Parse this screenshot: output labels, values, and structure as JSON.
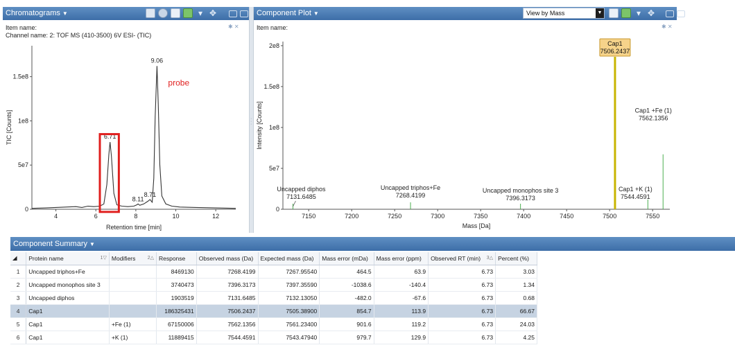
{
  "chromatogram": {
    "title": "Chromatograms",
    "item_name_label": "Item name:",
    "channel_label": "Channel name: 2: TOF MS (410-3500) 6V ESI- (TIC)",
    "annotation": "probe",
    "colors": {
      "trace": "#333333",
      "highlight_box": "#e0201f",
      "annotation": "#e0201f"
    },
    "chart_data": {
      "type": "line",
      "xlabel": "Retention time [min]",
      "ylabel": "TIC [Counts]",
      "xlim": [
        2.8,
        13.0
      ],
      "ylim": [
        0,
        185000000.0
      ],
      "x_ticks": [
        "4",
        "6",
        "8",
        "10",
        "12"
      ],
      "y_ticks": [
        "0",
        "5e7",
        "1e8",
        "1.5e8"
      ],
      "peak_labels": [
        {
          "x": 6.71,
          "y": 76000000.0,
          "text": "6.71"
        },
        {
          "x": 8.11,
          "y": 5000000.0,
          "text": "8.11"
        },
        {
          "x": 8.71,
          "y": 10000000.0,
          "text": "8.71"
        },
        {
          "x": 9.06,
          "y": 162000000.0,
          "text": "9.06"
        }
      ],
      "highlight_range": {
        "x": [
          6.2,
          7.15
        ],
        "y": [
          -3000000.0,
          85000000.0
        ]
      },
      "x": [
        2.8,
        3.5,
        4.0,
        4.5,
        5.0,
        5.3,
        5.6,
        5.9,
        6.2,
        6.4,
        6.55,
        6.65,
        6.71,
        6.78,
        6.9,
        7.05,
        7.3,
        7.6,
        7.9,
        8.05,
        8.11,
        8.2,
        8.4,
        8.6,
        8.71,
        8.82,
        8.9,
        8.97,
        9.06,
        9.12,
        9.2,
        9.3,
        9.5,
        9.8,
        10.2,
        11.0,
        12.0,
        13.0
      ],
      "y": [
        1000000.0,
        1500000.0,
        2000000.0,
        2500000.0,
        3000000.0,
        2000000.0,
        3500000.0,
        3000000.0,
        3500000.0,
        6000000.0,
        28000000.0,
        62000000.0,
        76000000.0,
        60000000.0,
        18000000.0,
        5000000.0,
        3500000.0,
        3000000.0,
        3500000.0,
        5000000.0,
        6000000.0,
        4500000.0,
        6000000.0,
        9000000.0,
        11000000.0,
        8000000.0,
        35000000.0,
        105000000.0,
        162000000.0,
        120000000.0,
        50000000.0,
        15000000.0,
        6000000.0,
        3500000.0,
        2500000.0,
        2000000.0,
        1500000.0,
        1000000.0
      ]
    }
  },
  "component_plot": {
    "title": "Component Plot",
    "item_name_label": "Item name:",
    "view_select": "View by Mass",
    "colors": {
      "stick": "#4caf50",
      "selected_stick": "#c8b400",
      "selected_label_bg": "#f6d38a",
      "selected_label_border": "#c89a30"
    },
    "chart_data": {
      "type": "bar",
      "xlabel": "Mass [Da]",
      "ylabel": "Intensity [Counts]",
      "xlim": [
        7120,
        7570
      ],
      "ylim": [
        0,
        205000000.0
      ],
      "x_ticks": [
        "7150",
        "7200",
        "7250",
        "7300",
        "7350",
        "7400",
        "7450",
        "7500",
        "7550"
      ],
      "y_ticks": [
        "0",
        "5e7",
        "1e8",
        "1.5e8",
        "2e8"
      ],
      "peaks": [
        {
          "mass": 7131.6485,
          "value": 1903519,
          "name": "Uncapped diphos",
          "mass_label": "7131.6485",
          "selected": false
        },
        {
          "mass": 7268.4199,
          "value": 8469130,
          "name": "Uncapped triphos+Fe",
          "mass_label": "7268.4199",
          "selected": false
        },
        {
          "mass": 7396.3173,
          "value": 3740473,
          "name": "Uncapped monophos site 3",
          "mass_label": "7396.3173",
          "selected": false
        },
        {
          "mass": 7506.2437,
          "value": 186325431,
          "name": "Cap1",
          "mass_label": "7506.2437",
          "selected": true
        },
        {
          "mass": 7544.4591,
          "value": 11889415,
          "name": "Cap1 +K (1)",
          "mass_label": "7544.4591",
          "selected": false
        },
        {
          "mass": 7562.1356,
          "value": 67150006,
          "name": "Cap1 +Fe (1)",
          "mass_label": "7562.1356",
          "selected": false
        }
      ]
    }
  },
  "summary": {
    "title": "Component Summary",
    "columns": [
      "Protein name",
      "Modifiers",
      "Response",
      "Observed mass (Da)",
      "Expected mass (Da)",
      "Mass error (mDa)",
      "Mass error (ppm)",
      "Observed RT (min)",
      "Percent (%)"
    ],
    "sort_indicators": {
      "protein": "1",
      "modifiers": "2",
      "observed_rt": "3"
    },
    "rows": [
      {
        "idx": "1",
        "protein": "Uncapped triphos+Fe",
        "modifiers": "",
        "response": "8469130",
        "observed": "7268.4199",
        "expected": "7267.95540",
        "err_mda": "464.5",
        "err_ppm": "63.9",
        "rt": "6.73",
        "percent": "3.03"
      },
      {
        "idx": "2",
        "protein": "Uncapped monophos site 3",
        "modifiers": "",
        "response": "3740473",
        "observed": "7396.3173",
        "expected": "7397.35590",
        "err_mda": "-1038.6",
        "err_ppm": "-140.4",
        "rt": "6.73",
        "percent": "1.34"
      },
      {
        "idx": "3",
        "protein": "Uncapped diphos",
        "modifiers": "",
        "response": "1903519",
        "observed": "7131.6485",
        "expected": "7132.13050",
        "err_mda": "-482.0",
        "err_ppm": "-67.6",
        "rt": "6.73",
        "percent": "0.68"
      },
      {
        "idx": "4",
        "protein": "Cap1",
        "modifiers": "",
        "response": "186325431",
        "observed": "7506.2437",
        "expected": "7505.38900",
        "err_mda": "854.7",
        "err_ppm": "113.9",
        "rt": "6.73",
        "percent": "66.67"
      },
      {
        "idx": "5",
        "protein": "Cap1",
        "modifiers": "+Fe (1)",
        "response": "67150006",
        "observed": "7562.1356",
        "expected": "7561.23400",
        "err_mda": "901.6",
        "err_ppm": "119.2",
        "rt": "6.73",
        "percent": "24.03"
      },
      {
        "idx": "6",
        "protein": "Cap1",
        "modifiers": "+K (1)",
        "response": "11889415",
        "observed": "7544.4591",
        "expected": "7543.47940",
        "err_mda": "979.7",
        "err_ppm": "129.9",
        "rt": "6.73",
        "percent": "4.25"
      }
    ],
    "selected_index": 3
  }
}
